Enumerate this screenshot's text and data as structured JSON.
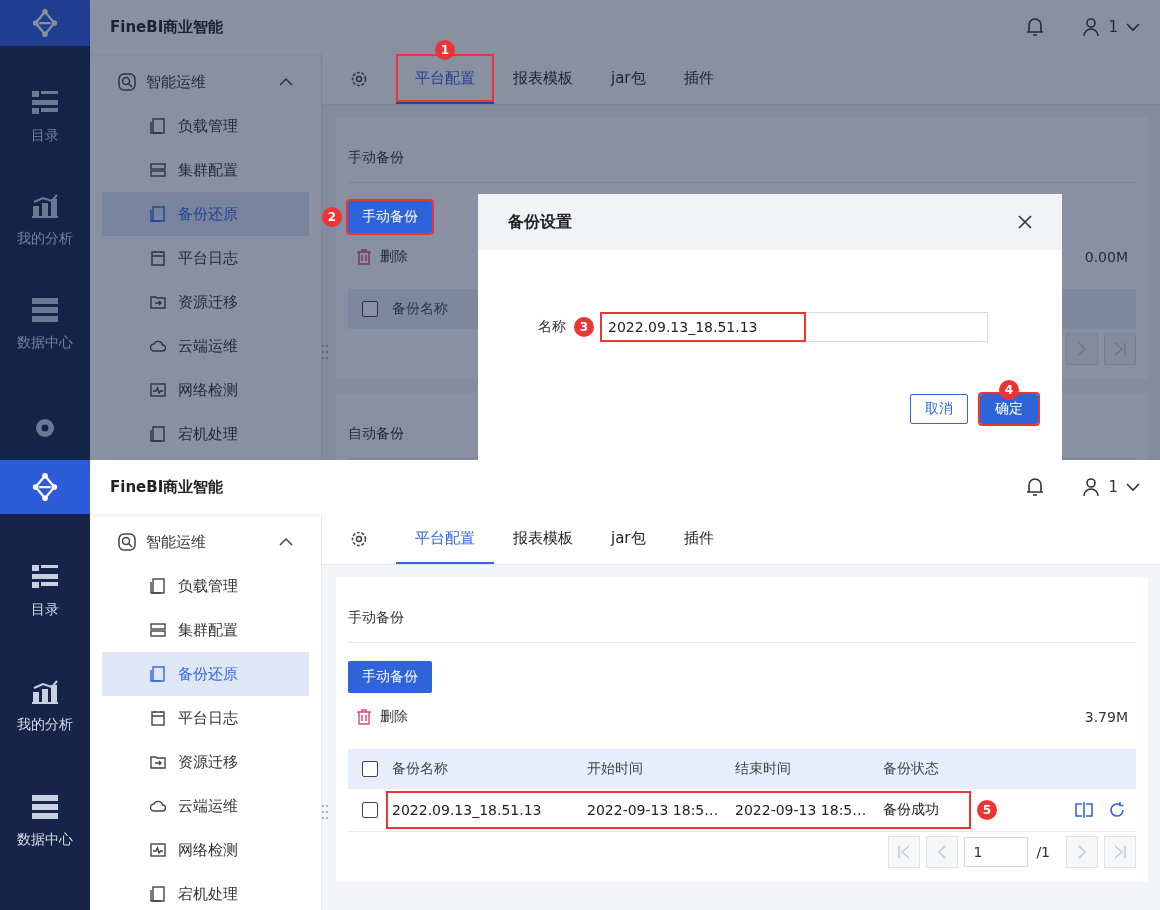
{
  "screens": [
    {
      "app_title": "FineBI商业智能",
      "user": "1",
      "nav": [
        {
          "label": "目录",
          "kind": "catalog"
        },
        {
          "label": "我的分析",
          "kind": "analysis"
        },
        {
          "label": "数据中心",
          "kind": "data"
        },
        {
          "kind": "system"
        }
      ],
      "menu": {
        "label": "智能运维",
        "expanded": true,
        "items": [
          {
            "label": "负载管理",
            "kind": "load",
            "selected": false
          },
          {
            "label": "集群配置",
            "kind": "cluster",
            "selected": false
          },
          {
            "label": "备份还原",
            "kind": "backup",
            "selected": true
          },
          {
            "label": "平台日志",
            "kind": "log",
            "selected": false
          },
          {
            "label": "资源迁移",
            "kind": "migrate",
            "selected": false
          },
          {
            "label": "云端运维",
            "kind": "cloud",
            "selected": false
          },
          {
            "label": "网络检测",
            "kind": "network",
            "selected": false
          },
          {
            "label": "宕机处理",
            "kind": "crash",
            "selected": false
          }
        ]
      },
      "tabs": [
        {
          "label": "平台配置",
          "selected": true,
          "callout": "1"
        },
        {
          "label": "报表模板",
          "selected": false
        },
        {
          "label": "jar包",
          "selected": false
        },
        {
          "label": "插件",
          "selected": false
        }
      ],
      "section_title": "手动备份",
      "backup_button": {
        "label": "手动备份",
        "callout": "2"
      },
      "delete_label": "删除",
      "size": "0.00M",
      "table": {
        "header_checked": false,
        "columns": [
          "备份名称"
        ]
      },
      "pagination": {
        "disabled": true
      },
      "lower_section_title": "自动备份",
      "dialog": {
        "title": "备份设置",
        "field_label": "名称",
        "value": "2022.09.13_18.51.13",
        "callout": "3",
        "buttons": [
          {
            "label": "取消",
            "kind": "secondary"
          },
          {
            "label": "确定",
            "kind": "primary",
            "callout": "4"
          }
        ]
      }
    },
    {
      "app_title": "FineBI商业智能",
      "user": "1",
      "nav": [
        {
          "label": "目录",
          "kind": "catalog"
        },
        {
          "label": "我的分析",
          "kind": "analysis"
        },
        {
          "label": "数据中心",
          "kind": "data"
        }
      ],
      "menu": {
        "label": "智能运维",
        "expanded": true,
        "items": [
          {
            "label": "负载管理",
            "kind": "load",
            "selected": false
          },
          {
            "label": "集群配置",
            "kind": "cluster",
            "selected": false
          },
          {
            "label": "备份还原",
            "kind": "backup",
            "selected": true
          },
          {
            "label": "平台日志",
            "kind": "log",
            "selected": false
          },
          {
            "label": "资源迁移",
            "kind": "migrate",
            "selected": false
          },
          {
            "label": "云端运维",
            "kind": "cloud",
            "selected": false
          },
          {
            "label": "网络检测",
            "kind": "network",
            "selected": false
          },
          {
            "label": "宕机处理",
            "kind": "crash",
            "selected": false
          }
        ]
      },
      "tabs": [
        {
          "label": "平台配置",
          "selected": true
        },
        {
          "label": "报表模板",
          "selected": false
        },
        {
          "label": "jar包",
          "selected": false
        },
        {
          "label": "插件",
          "selected": false
        }
      ],
      "section_title": "手动备份",
      "backup_button": {
        "label": "手动备份"
      },
      "delete_label": "删除",
      "size": "3.79M",
      "table": {
        "header_checked": false,
        "columns": [
          "备份名称",
          "开始时间",
          "结束时间",
          "备份状态"
        ],
        "rows": [
          {
            "checked": false,
            "callout": "5",
            "cells": [
              "2022.09.13_18.51.13",
              "2022-09-13 18:5…",
              "2022-09-13 18:5…",
              "备份成功"
            ]
          }
        ]
      },
      "pagination": {
        "disabled": true,
        "page": "1",
        "total": "/1"
      }
    }
  ]
}
